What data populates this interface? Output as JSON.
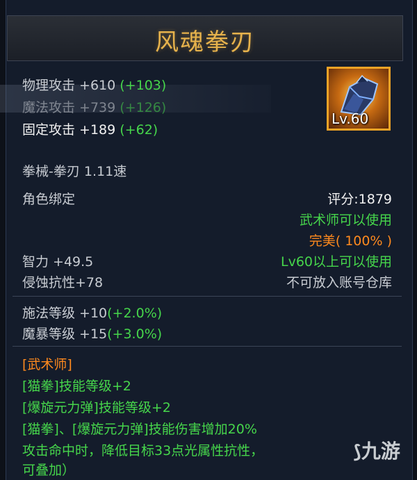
{
  "item": {
    "name": "风魂拳刃",
    "level_badge": "Lv.60",
    "stats": [
      {
        "label": "物理攻击 +610",
        "bonus": "(+103)"
      },
      {
        "label": "魔法攻击 +739",
        "bonus": "(+126)"
      },
      {
        "label": "固定攻击 +189",
        "bonus": "(+62)"
      }
    ],
    "weapon_type": "拳械-拳刃  1.11速",
    "bind": "角色绑定",
    "score": "评分:1879",
    "usable_class": "武术师可以使用",
    "quality": "完美( 100% )",
    "intellect": "智力 +49.5",
    "level_req": "Lv60以上可以使用",
    "erosion_res": "侵蚀抗性+78",
    "storage": "不可放入账号仓库",
    "cast_level": {
      "label": "施法等级 +10",
      "bonus": "(+2.0%)"
    },
    "crit_level": {
      "label": "魔暴等级 +15",
      "bonus": "(+3.0%)"
    },
    "class_header": "[武术师]",
    "skills": [
      "[猫拳]技能等级+2",
      "[爆旋元力弹]技能等级+2",
      "[猫拳]、[爆旋元力弹]技能伤害增加20%",
      "攻击命中时，降低目标33点光属性抗性，",
      "可叠加）"
    ],
    "watermark": "九游"
  },
  "colors": {
    "title": "#e6b24c",
    "green": "#46d64b",
    "orange": "#ff8a1e",
    "text": "#c8ccd2"
  }
}
